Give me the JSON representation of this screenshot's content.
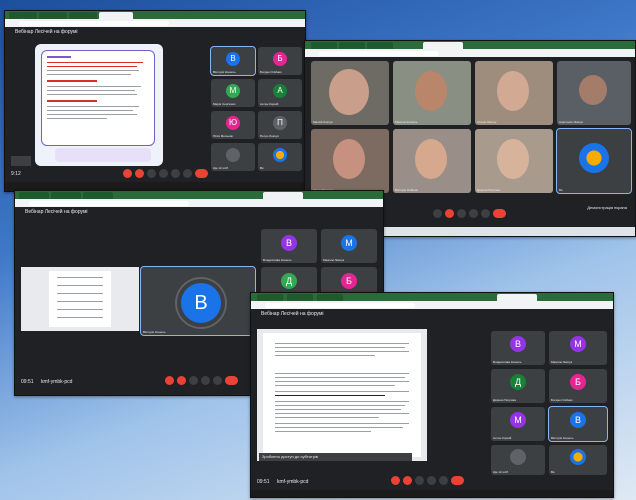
{
  "colors": {
    "meet_bg": "#202124",
    "tile_bg": "#3c4043",
    "end_call": "#ea4335",
    "avatar_blue": "#1a73e8"
  },
  "window1": {
    "title": "Вебінар Лесічей на форумі",
    "clock": "9:12",
    "participants": [
      {
        "initial": "В",
        "name": "Вікторія Кошель",
        "color": "#1a73e8"
      },
      {
        "initial": "Б",
        "name": "Богдан Олійник",
        "color": "#e52592"
      },
      {
        "initial": "М",
        "name": "Марія Сергієнко",
        "color": "#34a853"
      },
      {
        "initial": "А",
        "name": "Антон Корній",
        "color": "#188038"
      },
      {
        "initial": "Ю",
        "name": "Юлія Мельник",
        "color": "#e52592"
      },
      {
        "initial": "П",
        "name": "Петро Левчук",
        "color": "#5f6368"
      },
      {
        "initial": "",
        "name": "Ще 12 осіб",
        "color": "#5f6368"
      },
      {
        "initial": "",
        "name": "Ви",
        "color": "#f9ab00"
      }
    ]
  },
  "window2": {
    "participants": [
      "Матвій Левчук",
      "Максим Кошель",
      "Олена Левчук",
      "Анастасія Левчук",
      "Ірина Ткаченко",
      "Вікторія Олійник",
      "Дарина Петрова",
      "Ви"
    ],
    "footer": "Демонстрація екрана"
  },
  "window3": {
    "title": "Вебінар Лесічей на форумі",
    "main_initial": "В",
    "main_name": "Вікторія Кошель",
    "clock": "09:51",
    "meeting_code": "kmf-ymbk-pcd",
    "participants": [
      {
        "initial": "В",
        "name": "Владислава Кошель",
        "color": "#9334e6"
      },
      {
        "initial": "М",
        "name": "Максим Левчук",
        "color": "#1a73e8"
      },
      {
        "initial": "Д",
        "name": "Дарина Петрова",
        "color": "#34a853"
      },
      {
        "initial": "Б",
        "name": "Богдан Олійник",
        "color": "#e52592"
      }
    ]
  },
  "window4": {
    "title": "Вебінар Лесічей на форумі",
    "clock": "09:51",
    "meeting_code": "kmf-ymbk-pcd",
    "banner": "Зроблено доступ до субтитрів",
    "participants": [
      {
        "initial": "В",
        "name": "Владислава Кошель",
        "color": "#9334e6"
      },
      {
        "initial": "М",
        "name": "Максим Левчук",
        "color": "#9334e6"
      },
      {
        "initial": "Д",
        "name": "Дарина Петрова",
        "color": "#188038"
      },
      {
        "initial": "Б",
        "name": "Богдан Олійник",
        "color": "#e52592"
      },
      {
        "initial": "М",
        "name": "Антон Корній",
        "color": "#9334e6"
      },
      {
        "initial": "В",
        "name": "Вікторія Кошель",
        "color": "#1a73e8"
      },
      {
        "initial": "",
        "name": "Ще 12 осіб",
        "color": "#5f6368"
      },
      {
        "initial": "",
        "name": "Ви",
        "color": "#f9ab00"
      }
    ]
  }
}
